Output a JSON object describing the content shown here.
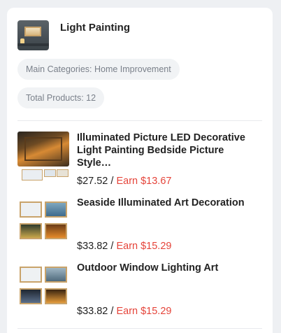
{
  "store": {
    "title": "Light Painting",
    "main_categories": "Main Categories: Home Improvement",
    "total_products": "Total Products: 12"
  },
  "products": [
    {
      "name": "Illuminated Picture LED Decorative Light Painting Bedside Picture Style…",
      "price": "$27.52",
      "separator": " / ",
      "earn": "Earn $13.67",
      "image_icon": "led-picture-thumbnail"
    },
    {
      "name": "Seaside Illuminated Art Decoration",
      "price": "$33.82",
      "separator": " / ",
      "earn": "Earn $15.29",
      "image_icon": "seaside-art-thumbnail"
    },
    {
      "name": "Outdoor Window Lighting Art",
      "price": "$33.82",
      "separator": " / ",
      "earn": "Earn $15.29",
      "image_icon": "window-art-thumbnail"
    }
  ],
  "colors": {
    "earn": "#e5443a",
    "pill_bg": "#f1f3f5",
    "pill_text": "#7a808a"
  }
}
